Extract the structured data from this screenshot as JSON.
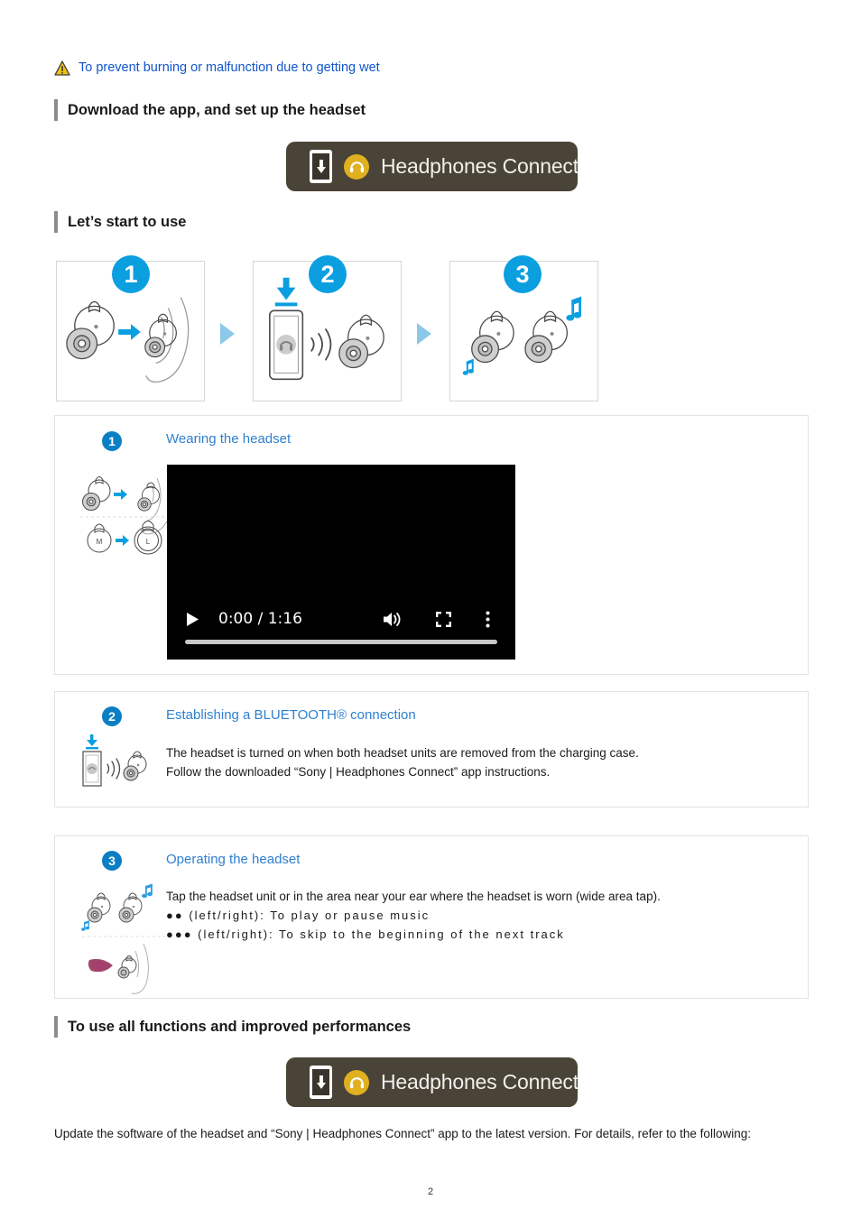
{
  "notice": {
    "icon": "warning-triangle-icon",
    "text": "To prevent burning or malfunction due to getting wet"
  },
  "sections": [
    {
      "title": "Download the app, and set up the headset"
    },
    {
      "title": "Let’s start to use"
    },
    {
      "title": "To use all functions and improved performances"
    }
  ],
  "banner": {
    "label": "Headphones Connect",
    "bg_color": "#4a4337",
    "badge_color": "#e0b020",
    "phone_icon": "phone-download-icon",
    "headphone_icon": "headphone-circle-icon"
  },
  "steps": [
    {
      "number": "1",
      "art": "earbud-to-ear-illustration"
    },
    {
      "number": "2",
      "art": "phone-download-bluetooth-earbud-illustration"
    },
    {
      "number": "3",
      "art": "earbuds-music-notes-illustration"
    }
  ],
  "cards": [
    {
      "number": "1",
      "title": "Wearing the headset",
      "art": "wearing-headset-illustration",
      "video": {
        "time_display": "0:00 / 1:16",
        "current_time": "0:00",
        "duration": "1:16",
        "play_icon": "play-icon",
        "volume_icon": "volume-icon",
        "fullscreen_icon": "fullscreen-icon",
        "more_icon": "more-options-icon",
        "progress_percent": 0
      }
    },
    {
      "number": "2",
      "title": "Establishing a BLUETOOTH® connection",
      "art": "bluetooth-pairing-illustration",
      "lines": [
        "The headset is turned on when both headset units are removed from the charging case.",
        "Follow the downloaded “Sony | Headphones Connect” app instructions."
      ]
    },
    {
      "number": "3",
      "title": "Operating the headset",
      "art": "tap-operation-illustration",
      "lines": [
        "Tap the headset unit or in the area near your ear where the headset is worn (wide area tap).",
        "●● (left/right): To play or pause music",
        "●●● (left/right): To skip to the beginning of the next track"
      ]
    }
  ],
  "footer": {
    "paragraph": "Update the software of the headset and “Sony | Headphones Connect” app to the latest version. For details, refer to the following:",
    "page_number": "2"
  },
  "colors": {
    "link_blue": "#1155cc",
    "title_blue": "#2f7fd0",
    "step_badge_blue": "#0b9fe0",
    "arrow_blue": "#8cc9e8",
    "heading_bar_gray": "#8c8c8c"
  }
}
